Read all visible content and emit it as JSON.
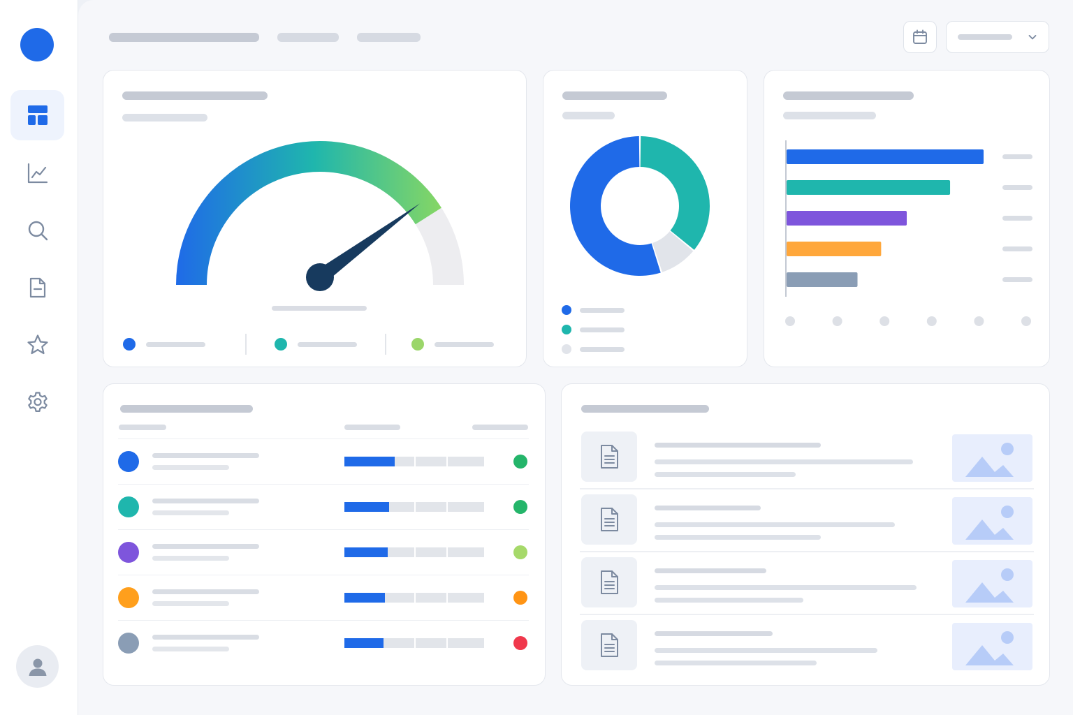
{
  "sidebar": {
    "logo_color": "#1f6ae8",
    "items": [
      {
        "icon": "dashboard-icon",
        "active": true
      },
      {
        "icon": "chart-line-icon",
        "active": false
      },
      {
        "icon": "search-icon",
        "active": false
      },
      {
        "icon": "document-icon",
        "active": false
      },
      {
        "icon": "star-icon",
        "active": false
      },
      {
        "icon": "gear-icon",
        "active": false
      }
    ],
    "avatar_icon": "user-icon"
  },
  "header": {
    "calendar_icon": "calendar-icon",
    "dropdown_icon": "chevron-down-icon"
  },
  "gauge": {
    "value": 0.82,
    "colors": {
      "start": "#1f6ae8",
      "mid": "#1fb6ad",
      "end": "#8ed95e",
      "track": "#ededf0",
      "needle": "#173a5e"
    },
    "legend_colors": [
      "#1f6ae8",
      "#1fb6ad",
      "#9bd66a"
    ]
  },
  "donut": {
    "segments": [
      {
        "value": 0.36,
        "color": "#1fb6ad"
      },
      {
        "value": 0.09,
        "color": "#e1e4ea"
      },
      {
        "value": 0.55,
        "color": "#1f6ae8"
      }
    ],
    "legend_colors": [
      "#1f6ae8",
      "#1fb6ad",
      "#e1e4ea"
    ]
  },
  "chart_data": {
    "type": "bar",
    "orientation": "horizontal",
    "values": [
      100,
      83,
      61,
      48,
      36
    ],
    "colors": [
      "#1f6ae8",
      "#1fb6ad",
      "#7e55dc",
      "#ffa73b",
      "#8a9db5"
    ],
    "xlim": [
      0,
      125
    ]
  },
  "table": {
    "rows": [
      {
        "avatar_color": "#1f6ae8",
        "progress": 0.36,
        "status_color": "#24b56a"
      },
      {
        "avatar_color": "#1fb6ad",
        "progress": 0.32,
        "status_color": "#24b56a"
      },
      {
        "avatar_color": "#7e55dc",
        "progress": 0.31,
        "status_color": "#a6d96a"
      },
      {
        "avatar_color": "#ff9f1c",
        "progress": 0.29,
        "status_color": "#ff9414"
      },
      {
        "avatar_color": "#8a9db5",
        "progress": 0.28,
        "status_color": "#f0384c"
      }
    ]
  },
  "files": {
    "items": [
      {
        "icon": "document-icon",
        "thumb_icon": "image-icon"
      },
      {
        "icon": "document-icon",
        "thumb_icon": "image-icon"
      },
      {
        "icon": "document-icon",
        "thumb_icon": "image-icon"
      },
      {
        "icon": "document-icon",
        "thumb_icon": "image-icon"
      }
    ]
  }
}
